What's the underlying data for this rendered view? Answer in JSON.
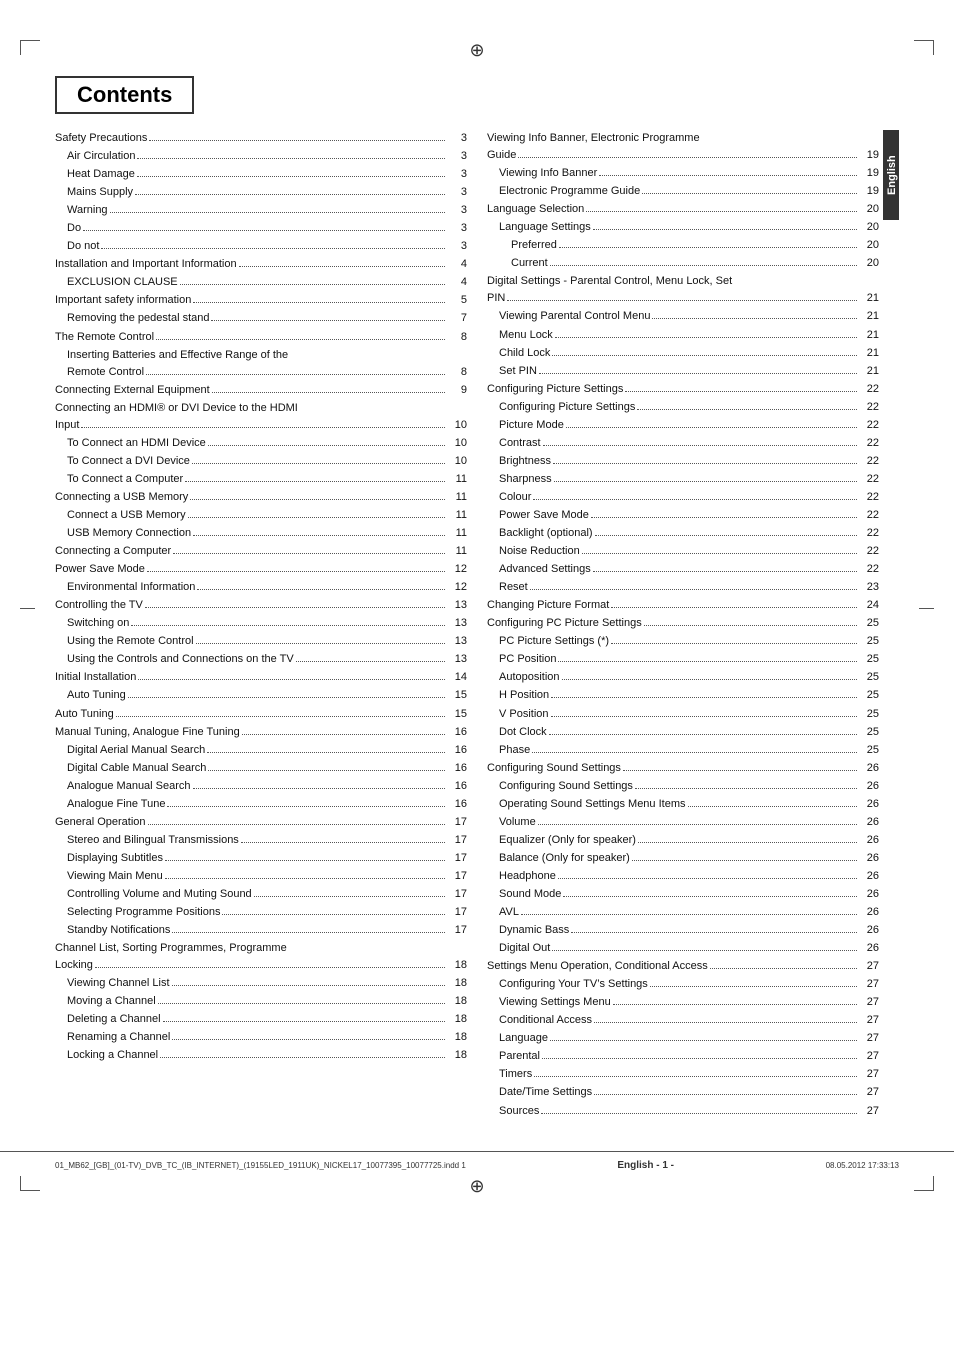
{
  "page": {
    "title": "Contents",
    "footer": {
      "left": "01_MB62_[GB]_(01-TV)_DVB_TC_(IB_INTERNET)_(19155LED_1911UK)_NICKEL17_10077395_10077725.indd  1",
      "center": "English  - 1 -",
      "right": "08.05.2012   17:33:13"
    },
    "sidebar_label": "English"
  },
  "toc_left": [
    {
      "title": "Safety Precautions",
      "dots": true,
      "page": "3",
      "indent": 0
    },
    {
      "title": "Air Circulation",
      "dots": true,
      "page": "3",
      "indent": 1
    },
    {
      "title": "Heat Damage",
      "dots": true,
      "page": "3",
      "indent": 1
    },
    {
      "title": "Mains Supply",
      "dots": true,
      "page": "3",
      "indent": 1
    },
    {
      "title": "Warning",
      "dots": true,
      "page": "3",
      "indent": 1
    },
    {
      "title": "Do",
      "dots": true,
      "page": "3",
      "indent": 1
    },
    {
      "title": "Do not",
      "dots": true,
      "page": "3",
      "indent": 1
    },
    {
      "title": "Installation and Important Information",
      "dots": true,
      "page": "4",
      "indent": 0
    },
    {
      "title": "EXCLUSION CLAUSE",
      "dots": true,
      "page": "4",
      "indent": 1
    },
    {
      "title": "Important safety information",
      "dots": true,
      "page": "5",
      "indent": 0
    },
    {
      "title": "Removing the pedestal stand",
      "dots": true,
      "page": "7",
      "indent": 1
    },
    {
      "title": "The Remote Control",
      "dots": true,
      "page": "8",
      "indent": 0
    },
    {
      "title": "Inserting Batteries and Effective Range of the Remote Control",
      "dots": true,
      "page": "8",
      "indent": 1,
      "multiline": true,
      "line1": "Inserting Batteries and Effective Range of the",
      "line2": "Remote Control"
    },
    {
      "title": "Connecting External Equipment",
      "dots": true,
      "page": "9",
      "indent": 0
    },
    {
      "title": "Connecting an HDMI® or DVI Device to the HDMI Input",
      "dots": true,
      "page": "10",
      "indent": 0,
      "multiline": true,
      "line1": "Connecting an HDMI® or DVI Device to the HDMI",
      "line2": "Input"
    },
    {
      "title": "To Connect an HDMI Device",
      "dots": true,
      "page": "10",
      "indent": 1
    },
    {
      "title": "To Connect a DVI Device",
      "dots": true,
      "page": "10",
      "indent": 1
    },
    {
      "title": "To Connect a Computer",
      "dots": true,
      "page": "11",
      "indent": 1
    },
    {
      "title": "Connecting a USB Memory",
      "dots": true,
      "page": "11",
      "indent": 0
    },
    {
      "title": "Connect a USB Memory",
      "dots": true,
      "page": "11",
      "indent": 1
    },
    {
      "title": "USB Memory Connection",
      "dots": true,
      "page": "11",
      "indent": 1
    },
    {
      "title": "Connecting a Computer",
      "dots": true,
      "page": "11",
      "indent": 0
    },
    {
      "title": "Power Save Mode",
      "dots": true,
      "page": "12",
      "indent": 0
    },
    {
      "title": "Environmental Information",
      "dots": true,
      "page": "12",
      "indent": 1
    },
    {
      "title": "Controlling the TV",
      "dots": true,
      "page": "13",
      "indent": 0
    },
    {
      "title": "Switching on",
      "dots": true,
      "page": "13",
      "indent": 1
    },
    {
      "title": "Using the Remote Control",
      "dots": true,
      "page": "13",
      "indent": 1
    },
    {
      "title": "Using the Controls and Connections on the TV",
      "dots": true,
      "page": "13",
      "indent": 1
    },
    {
      "title": "Initial Installation",
      "dots": true,
      "page": "14",
      "indent": 0
    },
    {
      "title": "Auto Tuning",
      "dots": true,
      "page": "15",
      "indent": 1
    },
    {
      "title": "Auto Tuning",
      "dots": true,
      "page": "15",
      "indent": 0
    },
    {
      "title": "Manual Tuning, Analogue Fine Tuning",
      "dots": true,
      "page": "16",
      "indent": 0
    },
    {
      "title": "Digital Aerial Manual Search",
      "dots": true,
      "page": "16",
      "indent": 1
    },
    {
      "title": "Digital Cable Manual Search",
      "dots": true,
      "page": "16",
      "indent": 1
    },
    {
      "title": "Analogue Manual Search",
      "dots": true,
      "page": "16",
      "indent": 1
    },
    {
      "title": "Analogue Fine Tune",
      "dots": true,
      "page": "16",
      "indent": 1
    },
    {
      "title": "General Operation",
      "dots": true,
      "page": "17",
      "indent": 0
    },
    {
      "title": "Stereo and Bilingual Transmissions",
      "dots": true,
      "page": "17",
      "indent": 1
    },
    {
      "title": "Displaying Subtitles",
      "dots": true,
      "page": "17",
      "indent": 1
    },
    {
      "title": "Viewing Main Menu",
      "dots": true,
      "page": "17",
      "indent": 1
    },
    {
      "title": "Controlling Volume and Muting Sound",
      "dots": true,
      "page": "17",
      "indent": 1
    },
    {
      "title": "Selecting Programme Positions",
      "dots": true,
      "page": "17",
      "indent": 1
    },
    {
      "title": "Standby Notifications",
      "dots": true,
      "page": "17",
      "indent": 1
    },
    {
      "title": "Channel List, Sorting Programmes, Programme Locking",
      "dots": true,
      "page": "18",
      "indent": 0,
      "multiline": true,
      "line1": "Channel List, Sorting Programmes, Programme",
      "line2": "Locking"
    },
    {
      "title": "Viewing Channel List",
      "dots": true,
      "page": "18",
      "indent": 1
    },
    {
      "title": "Moving a Channel",
      "dots": true,
      "page": "18",
      "indent": 1
    },
    {
      "title": "Deleting a Channel",
      "dots": true,
      "page": "18",
      "indent": 1
    },
    {
      "title": "Renaming a Channel",
      "dots": true,
      "page": "18",
      "indent": 1
    },
    {
      "title": "Locking a Channel",
      "dots": true,
      "page": "18",
      "indent": 1
    }
  ],
  "toc_right": [
    {
      "title": "Viewing Info Banner, Electronic Programme Guide",
      "dots": true,
      "page": "19",
      "indent": 0,
      "multiline": true,
      "line1": "Viewing Info Banner, Electronic Programme",
      "line2": "Guide"
    },
    {
      "title": "Viewing Info Banner",
      "dots": true,
      "page": "19",
      "indent": 1
    },
    {
      "title": "Electronic Programme Guide",
      "dots": true,
      "page": "19",
      "indent": 1
    },
    {
      "title": "Language Selection",
      "dots": true,
      "page": "20",
      "indent": 0
    },
    {
      "title": "Language Settings",
      "dots": true,
      "page": "20",
      "indent": 1
    },
    {
      "title": "Preferred",
      "dots": true,
      "page": "20",
      "indent": 2
    },
    {
      "title": "Current",
      "dots": true,
      "page": "20",
      "indent": 2
    },
    {
      "title": "Digital Settings - Parental Control, Menu Lock, Set PIN",
      "dots": true,
      "page": "21",
      "indent": 0,
      "multiline": true,
      "line1": "Digital Settings - Parental Control, Menu Lock, Set",
      "line2": "PIN"
    },
    {
      "title": "Viewing Parental Control Menu",
      "dots": true,
      "page": "21",
      "indent": 1
    },
    {
      "title": "Menu Lock",
      "dots": true,
      "page": "21",
      "indent": 1
    },
    {
      "title": "Child Lock",
      "dots": true,
      "page": "21",
      "indent": 1
    },
    {
      "title": "Set PIN",
      "dots": true,
      "page": "21",
      "indent": 1
    },
    {
      "title": "Configuring Picture Settings",
      "dots": true,
      "page": "22",
      "indent": 0
    },
    {
      "title": "Configuring Picture Settings",
      "dots": true,
      "page": "22",
      "indent": 1
    },
    {
      "title": "Picture Mode",
      "dots": true,
      "page": "22",
      "indent": 1
    },
    {
      "title": "Contrast",
      "dots": true,
      "page": "22",
      "indent": 1
    },
    {
      "title": "Brightness",
      "dots": true,
      "page": "22",
      "indent": 1
    },
    {
      "title": "Sharpness",
      "dots": true,
      "page": "22",
      "indent": 1
    },
    {
      "title": "Colour",
      "dots": true,
      "page": "22",
      "indent": 1
    },
    {
      "title": "Power Save Mode",
      "dots": true,
      "page": "22",
      "indent": 1
    },
    {
      "title": "Backlight (optional)",
      "dots": true,
      "page": "22",
      "indent": 1
    },
    {
      "title": "Noise Reduction",
      "dots": true,
      "page": "22",
      "indent": 1
    },
    {
      "title": "Advanced Settings",
      "dots": true,
      "page": "22",
      "indent": 1
    },
    {
      "title": "Reset",
      "dots": true,
      "page": "23",
      "indent": 1
    },
    {
      "title": "Changing Picture Format",
      "dots": true,
      "page": "24",
      "indent": 0
    },
    {
      "title": "Configuring PC Picture Settings",
      "dots": true,
      "page": "25",
      "indent": 0
    },
    {
      "title": "PC Picture Settings (*)",
      "dots": true,
      "page": "25",
      "indent": 1
    },
    {
      "title": "PC Position",
      "dots": true,
      "page": "25",
      "indent": 1
    },
    {
      "title": "Autoposition",
      "dots": true,
      "page": "25",
      "indent": 1
    },
    {
      "title": "H Position",
      "dots": true,
      "page": "25",
      "indent": 1
    },
    {
      "title": "V Position",
      "dots": true,
      "page": "25",
      "indent": 1
    },
    {
      "title": "Dot Clock",
      "dots": true,
      "page": "25",
      "indent": 1
    },
    {
      "title": "Phase",
      "dots": true,
      "page": "25",
      "indent": 1
    },
    {
      "title": "Configuring Sound Settings",
      "dots": true,
      "page": "26",
      "indent": 0
    },
    {
      "title": "Configuring Sound Settings",
      "dots": true,
      "page": "26",
      "indent": 1
    },
    {
      "title": "Operating Sound Settings Menu Items",
      "dots": true,
      "page": "26",
      "indent": 1
    },
    {
      "title": "Volume",
      "dots": true,
      "page": "26",
      "indent": 1
    },
    {
      "title": "Equalizer (Only for speaker)",
      "dots": true,
      "page": "26",
      "indent": 1
    },
    {
      "title": "Balance (Only for speaker)",
      "dots": true,
      "page": "26",
      "indent": 1
    },
    {
      "title": "Headphone",
      "dots": true,
      "page": "26",
      "indent": 1
    },
    {
      "title": "Sound Mode",
      "dots": true,
      "page": "26",
      "indent": 1
    },
    {
      "title": "AVL",
      "dots": true,
      "page": "26",
      "indent": 1
    },
    {
      "title": "Dynamic Bass",
      "dots": true,
      "page": "26",
      "indent": 1
    },
    {
      "title": "Digital Out",
      "dots": true,
      "page": "26",
      "indent": 1
    },
    {
      "title": "Settings Menu Operation, Conditional Access",
      "dots": true,
      "page": "27",
      "indent": 0
    },
    {
      "title": "Configuring Your TV’s Settings",
      "dots": true,
      "page": "27",
      "indent": 1
    },
    {
      "title": "Viewing Settings Menu",
      "dots": true,
      "page": "27",
      "indent": 1
    },
    {
      "title": "Conditional Access",
      "dots": true,
      "page": "27",
      "indent": 1
    },
    {
      "title": "Language",
      "dots": true,
      "page": "27",
      "indent": 1
    },
    {
      "title": "Parental",
      "dots": true,
      "page": "27",
      "indent": 1
    },
    {
      "title": "Timers",
      "dots": true,
      "page": "27",
      "indent": 1
    },
    {
      "title": "Date/Time Settings",
      "dots": true,
      "page": "27",
      "indent": 1
    },
    {
      "title": "Sources",
      "dots": true,
      "page": "27",
      "indent": 1
    }
  ]
}
